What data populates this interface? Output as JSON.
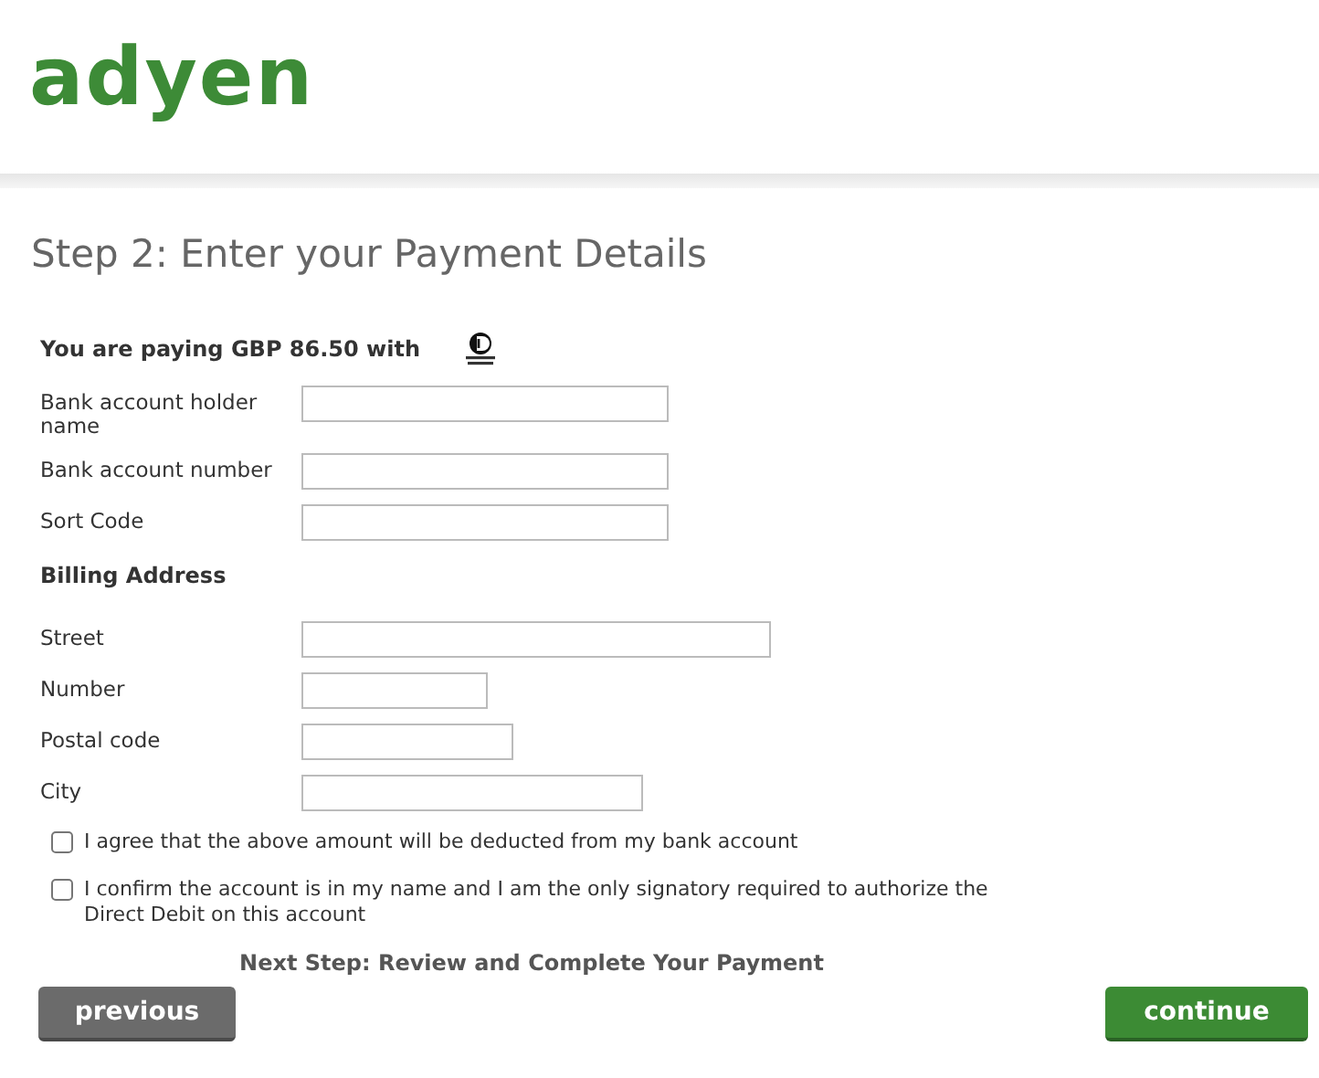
{
  "logo": "adyen",
  "title": "Step 2: Enter your Payment Details",
  "paying": "You are paying GBP 86.50 with",
  "fields": [
    {
      "label": "Bank account holder name"
    },
    {
      "label": "Bank account number"
    },
    {
      "label": "Sort Code"
    }
  ],
  "billing_heading": "Billing Address",
  "address_fields": [
    {
      "label": "Street"
    },
    {
      "label": "Number"
    },
    {
      "label": "Postal code"
    },
    {
      "label": "City"
    }
  ],
  "agreements": [
    {
      "text": "I agree that the above amount will be deducted from my bank account",
      "checked": false
    },
    {
      "text": "I confirm the account is in my name and I am the only signatory required to authorize the Direct Debit on this account",
      "checked": false
    }
  ],
  "next_step": "Next Step: Review and Complete Your Payment",
  "buttons": [
    {
      "label": "previous",
      "kind": "secondary"
    },
    {
      "label": "continue",
      "kind": "primary"
    }
  ]
}
